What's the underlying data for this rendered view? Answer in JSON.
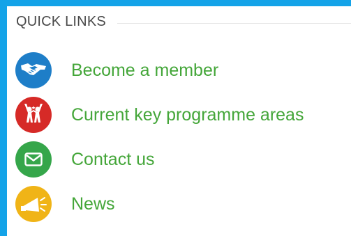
{
  "quick_links": {
    "title": "QUICK LINKS",
    "items": [
      {
        "label": "Become a member",
        "icon": "handshake-icon",
        "color": "#1e7ec8"
      },
      {
        "label": "Current key programme areas",
        "icon": "people-raising-hands-icon",
        "color": "#d62a27"
      },
      {
        "label": "Contact us",
        "icon": "envelope-icon",
        "color": "#35a64a"
      },
      {
        "label": "News",
        "icon": "megaphone-icon",
        "color": "#f0b417"
      }
    ]
  }
}
